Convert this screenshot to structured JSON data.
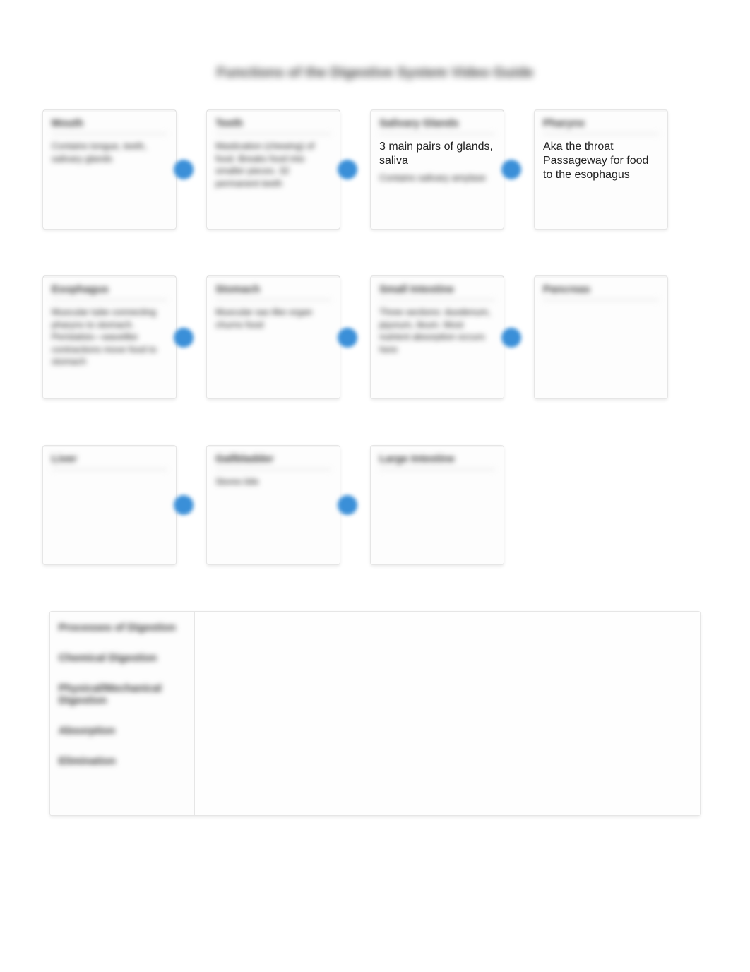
{
  "title": "Functions of the Digestive System Video Guide",
  "rows": [
    [
      {
        "header": "Mouth",
        "body": "Contains tongue, teeth, salivary glands",
        "clear": false
      },
      {
        "header": "Teeth",
        "body": "Mastication (chewing) of food. Breaks food into smaller pieces. 32 permanent teeth",
        "clear": false
      },
      {
        "header": "Salivary Glands",
        "body": "3 main pairs of glands, saliva",
        "clear": true,
        "blurred_extra": "Contains salivary amylase"
      },
      {
        "header": "Pharynx",
        "body": "Aka the throat Passageway for food to the esophagus",
        "clear": true
      }
    ],
    [
      {
        "header": "Esophagus",
        "body": "Muscular tube connecting pharynx to stomach. Peristalsis—wavelike contractions move food to stomach",
        "clear": false
      },
      {
        "header": "Stomach",
        "body": "Muscular sac-like organ churns food",
        "clear": false
      },
      {
        "header": "Small Intestine",
        "body": "Three sections: duodenum, jejunum, ileum. Most nutrient absorption occurs here",
        "clear": false
      },
      {
        "header": "Pancreas",
        "body": "",
        "clear": false
      }
    ],
    [
      {
        "header": "Liver",
        "body": "",
        "clear": false
      },
      {
        "header": "Gallbladder",
        "body": "Stores bile",
        "clear": false
      },
      {
        "header": "Large Intestine",
        "body": "",
        "clear": false
      }
    ]
  ],
  "terms": [
    "Processes of Digestion",
    "Chemical Digestion",
    "Physical/Mechanical Digestion",
    "Absorption",
    "Elimination"
  ]
}
